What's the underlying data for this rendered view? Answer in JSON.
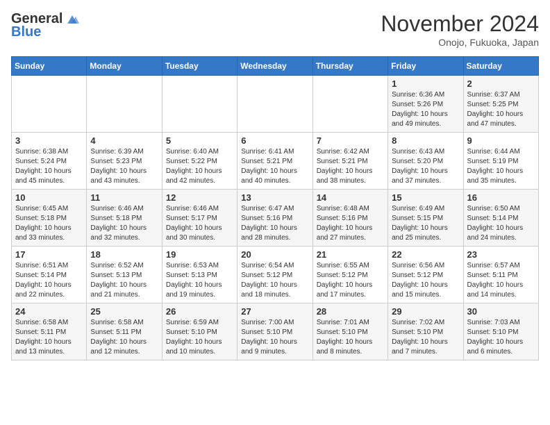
{
  "header": {
    "logo_general": "General",
    "logo_blue": "Blue",
    "month_title": "November 2024",
    "location": "Onojo, Fukuoka, Japan"
  },
  "weekdays": [
    "Sunday",
    "Monday",
    "Tuesday",
    "Wednesday",
    "Thursday",
    "Friday",
    "Saturday"
  ],
  "weeks": [
    [
      {
        "day": "",
        "info": ""
      },
      {
        "day": "",
        "info": ""
      },
      {
        "day": "",
        "info": ""
      },
      {
        "day": "",
        "info": ""
      },
      {
        "day": "",
        "info": ""
      },
      {
        "day": "1",
        "info": "Sunrise: 6:36 AM\nSunset: 5:26 PM\nDaylight: 10 hours\nand 49 minutes."
      },
      {
        "day": "2",
        "info": "Sunrise: 6:37 AM\nSunset: 5:25 PM\nDaylight: 10 hours\nand 47 minutes."
      }
    ],
    [
      {
        "day": "3",
        "info": "Sunrise: 6:38 AM\nSunset: 5:24 PM\nDaylight: 10 hours\nand 45 minutes."
      },
      {
        "day": "4",
        "info": "Sunrise: 6:39 AM\nSunset: 5:23 PM\nDaylight: 10 hours\nand 43 minutes."
      },
      {
        "day": "5",
        "info": "Sunrise: 6:40 AM\nSunset: 5:22 PM\nDaylight: 10 hours\nand 42 minutes."
      },
      {
        "day": "6",
        "info": "Sunrise: 6:41 AM\nSunset: 5:21 PM\nDaylight: 10 hours\nand 40 minutes."
      },
      {
        "day": "7",
        "info": "Sunrise: 6:42 AM\nSunset: 5:21 PM\nDaylight: 10 hours\nand 38 minutes."
      },
      {
        "day": "8",
        "info": "Sunrise: 6:43 AM\nSunset: 5:20 PM\nDaylight: 10 hours\nand 37 minutes."
      },
      {
        "day": "9",
        "info": "Sunrise: 6:44 AM\nSunset: 5:19 PM\nDaylight: 10 hours\nand 35 minutes."
      }
    ],
    [
      {
        "day": "10",
        "info": "Sunrise: 6:45 AM\nSunset: 5:18 PM\nDaylight: 10 hours\nand 33 minutes."
      },
      {
        "day": "11",
        "info": "Sunrise: 6:46 AM\nSunset: 5:18 PM\nDaylight: 10 hours\nand 32 minutes."
      },
      {
        "day": "12",
        "info": "Sunrise: 6:46 AM\nSunset: 5:17 PM\nDaylight: 10 hours\nand 30 minutes."
      },
      {
        "day": "13",
        "info": "Sunrise: 6:47 AM\nSunset: 5:16 PM\nDaylight: 10 hours\nand 28 minutes."
      },
      {
        "day": "14",
        "info": "Sunrise: 6:48 AM\nSunset: 5:16 PM\nDaylight: 10 hours\nand 27 minutes."
      },
      {
        "day": "15",
        "info": "Sunrise: 6:49 AM\nSunset: 5:15 PM\nDaylight: 10 hours\nand 25 minutes."
      },
      {
        "day": "16",
        "info": "Sunrise: 6:50 AM\nSunset: 5:14 PM\nDaylight: 10 hours\nand 24 minutes."
      }
    ],
    [
      {
        "day": "17",
        "info": "Sunrise: 6:51 AM\nSunset: 5:14 PM\nDaylight: 10 hours\nand 22 minutes."
      },
      {
        "day": "18",
        "info": "Sunrise: 6:52 AM\nSunset: 5:13 PM\nDaylight: 10 hours\nand 21 minutes."
      },
      {
        "day": "19",
        "info": "Sunrise: 6:53 AM\nSunset: 5:13 PM\nDaylight: 10 hours\nand 19 minutes."
      },
      {
        "day": "20",
        "info": "Sunrise: 6:54 AM\nSunset: 5:12 PM\nDaylight: 10 hours\nand 18 minutes."
      },
      {
        "day": "21",
        "info": "Sunrise: 6:55 AM\nSunset: 5:12 PM\nDaylight: 10 hours\nand 17 minutes."
      },
      {
        "day": "22",
        "info": "Sunrise: 6:56 AM\nSunset: 5:12 PM\nDaylight: 10 hours\nand 15 minutes."
      },
      {
        "day": "23",
        "info": "Sunrise: 6:57 AM\nSunset: 5:11 PM\nDaylight: 10 hours\nand 14 minutes."
      }
    ],
    [
      {
        "day": "24",
        "info": "Sunrise: 6:58 AM\nSunset: 5:11 PM\nDaylight: 10 hours\nand 13 minutes."
      },
      {
        "day": "25",
        "info": "Sunrise: 6:58 AM\nSunset: 5:11 PM\nDaylight: 10 hours\nand 12 minutes."
      },
      {
        "day": "26",
        "info": "Sunrise: 6:59 AM\nSunset: 5:10 PM\nDaylight: 10 hours\nand 10 minutes."
      },
      {
        "day": "27",
        "info": "Sunrise: 7:00 AM\nSunset: 5:10 PM\nDaylight: 10 hours\nand 9 minutes."
      },
      {
        "day": "28",
        "info": "Sunrise: 7:01 AM\nSunset: 5:10 PM\nDaylight: 10 hours\nand 8 minutes."
      },
      {
        "day": "29",
        "info": "Sunrise: 7:02 AM\nSunset: 5:10 PM\nDaylight: 10 hours\nand 7 minutes."
      },
      {
        "day": "30",
        "info": "Sunrise: 7:03 AM\nSunset: 5:10 PM\nDaylight: 10 hours\nand 6 minutes."
      }
    ]
  ]
}
